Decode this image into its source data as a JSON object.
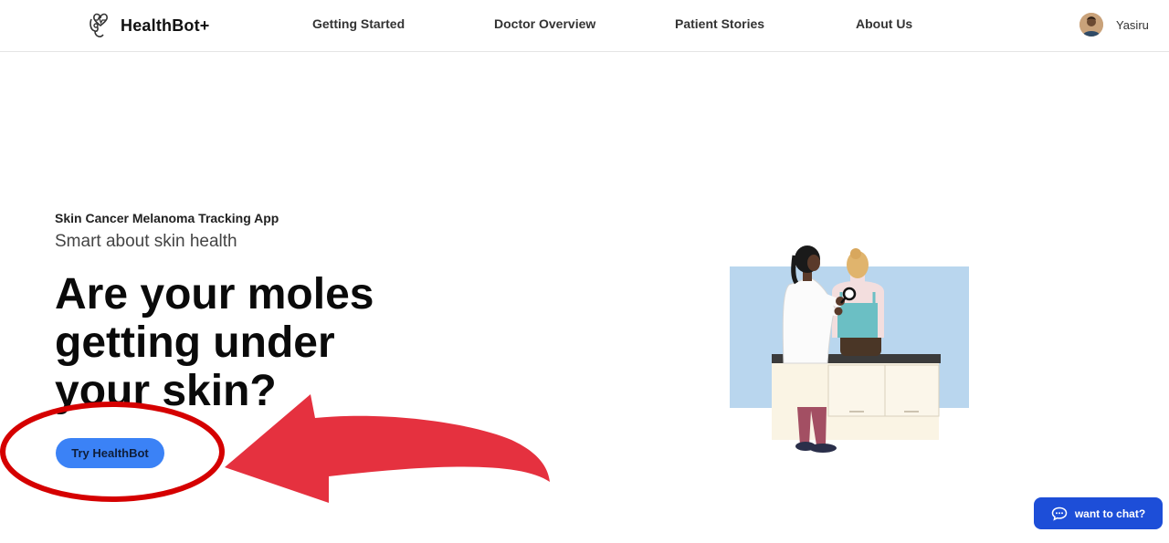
{
  "header": {
    "brand": "HealthBot+",
    "nav": [
      {
        "label": "Getting Started"
      },
      {
        "label": "Doctor Overview"
      },
      {
        "label": "Patient Stories"
      },
      {
        "label": "About Us"
      }
    ],
    "user": {
      "name": "Yasiru"
    }
  },
  "hero": {
    "eyebrow": "Skin Cancer Melanoma Tracking App",
    "subtitle": "Smart about skin health",
    "headline": "Are your moles getting under your skin?",
    "cta_label": "Try HealthBot"
  },
  "chat": {
    "label": "want to chat?"
  },
  "colors": {
    "primary": "#3b82f6",
    "chat": "#1d4ed8",
    "annotation": "#e0242f"
  },
  "icons": [
    "stethoscope-heart-icon",
    "chat-bubble-icon",
    "user-avatar"
  ]
}
